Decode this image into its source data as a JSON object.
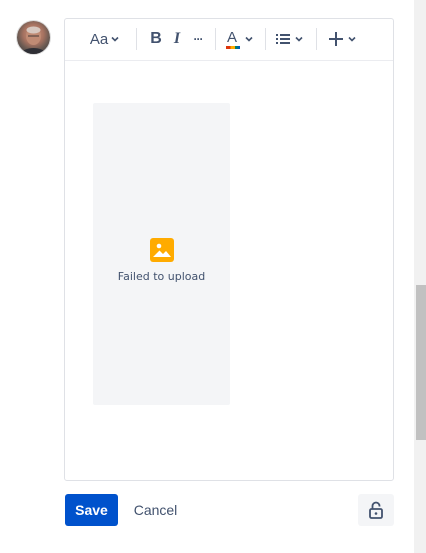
{
  "user": {
    "avatar_icon": "user-avatar"
  },
  "toolbar": {
    "text_style_label": "Aa",
    "bold_label": "B",
    "italic_label": "I",
    "more_label": "···",
    "text_color_label": "A",
    "icons": [
      "chevron-down-icon",
      "list-icon",
      "plus-icon"
    ]
  },
  "media": {
    "status_text": "Failed to upload",
    "icon": "image-icon",
    "icon_color": "#ffab00"
  },
  "actions": {
    "save_label": "Save",
    "cancel_label": "Cancel",
    "restrictions_icon": "unlock-icon"
  },
  "colors": {
    "primary": "#0052cc",
    "text": "#42526e"
  }
}
